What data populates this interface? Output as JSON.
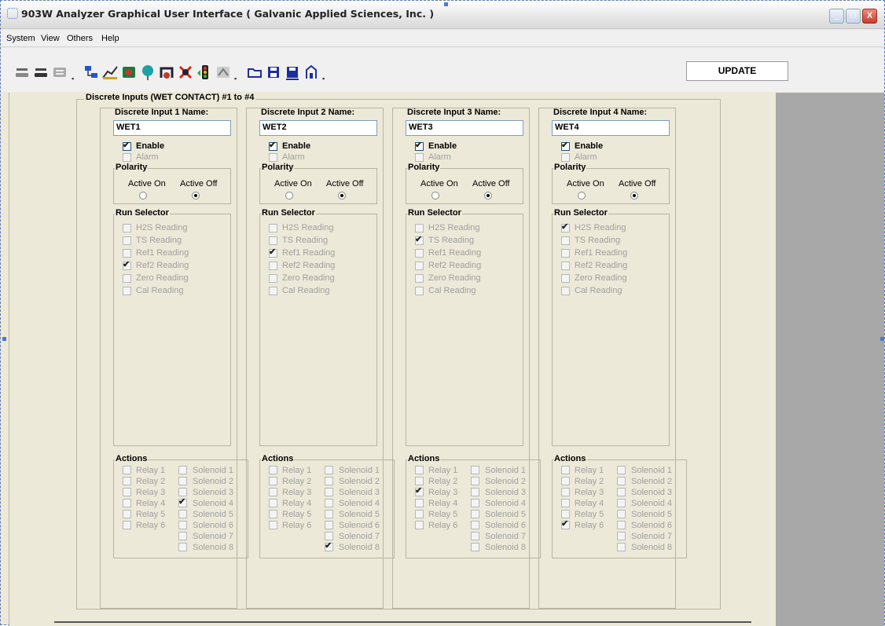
{
  "window": {
    "title": "903W Analyzer Graphical User Interface  ( Galvanic Applied Sciences, Inc. )",
    "controls": [
      "minimize",
      "maximize",
      "close"
    ]
  },
  "menu": [
    "System",
    "View",
    "Others",
    "Help"
  ],
  "toolbar": {
    "update_label": "UPDATE",
    "icons": [
      "connect-icon",
      "disconnect-icon",
      "settings-icon",
      "network-icon",
      "chart-icon",
      "config-icon",
      "balloon-icon",
      "valves-icon",
      "alarm-icon",
      "signal-icon",
      "calibrate-icon",
      "open-folder-icon",
      "save-icon",
      "save-as-icon",
      "print-icon"
    ]
  },
  "group": {
    "title": "Discrete Inputs (WET CONTACT) #1 to #4"
  },
  "labels": {
    "enable": "Enable",
    "alarm": "Alarm",
    "polarity": "Polarity",
    "active_on": "Active On",
    "active_off": "Active Off",
    "run_selector": "Run Selector",
    "actions": "Actions",
    "run_items": [
      "H2S Reading",
      "TS Reading",
      "Ref1 Reading",
      "Ref2 Reading",
      "Zero Reading",
      "Cal Reading"
    ],
    "relays": [
      "Relay 1",
      "Relay 2",
      "Relay 3",
      "Relay 4",
      "Relay 5",
      "Relay 6"
    ],
    "solenoids": [
      "Solenoid 1",
      "Solenoid 2",
      "Solenoid 3",
      "Solenoid 4",
      "Solenoid 5",
      "Solenoid 6",
      "Solenoid 7",
      "Solenoid 8"
    ]
  },
  "inputs": [
    {
      "label": "Discrete Input 1 Name:",
      "name": "WET1",
      "enabled": true,
      "alarm": false,
      "polarity": "Active Off",
      "run": "Ref2 Reading",
      "relays_checked": [],
      "solenoids_checked": [
        "Solenoid 4"
      ]
    },
    {
      "label": "Discrete Input 2 Name:",
      "name": "WET2",
      "enabled": true,
      "alarm": false,
      "polarity": "Active Off",
      "run": "Ref1 Reading",
      "relays_checked": [],
      "solenoids_checked": [
        "Solenoid 8"
      ]
    },
    {
      "label": "Discrete Input 3 Name:",
      "name": "WET3",
      "enabled": true,
      "alarm": false,
      "polarity": "Active Off",
      "run": "TS Reading",
      "relays_checked": [
        "Relay 3"
      ],
      "solenoids_checked": []
    },
    {
      "label": "Discrete Input 4 Name:",
      "name": "WET4",
      "enabled": true,
      "alarm": false,
      "polarity": "Active Off",
      "run": "H2S Reading",
      "relays_checked": [
        "Relay 6"
      ],
      "solenoids_checked": []
    }
  ]
}
